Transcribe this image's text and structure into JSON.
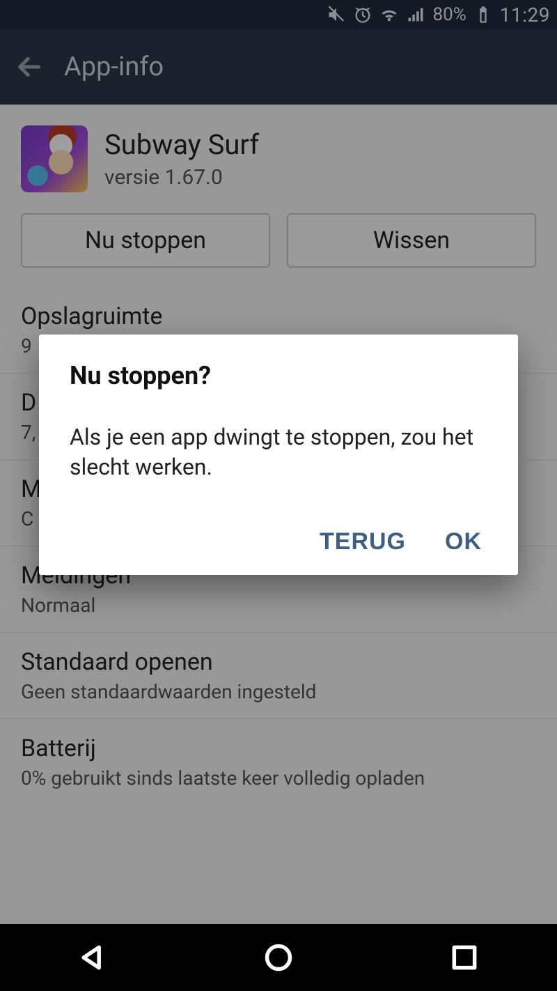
{
  "statusbar": {
    "battery_pct": "80%",
    "clock": "11:29"
  },
  "appbar": {
    "title": "App-info"
  },
  "app": {
    "name": "Subway Surf",
    "version": "versie 1.67.0"
  },
  "buttons": {
    "force_stop": "Nu stoppen",
    "uninstall": "Wissen"
  },
  "rows": {
    "storage": {
      "title": "Opslagruimte",
      "sub": "9"
    },
    "data": {
      "title": "D",
      "sub": "7,"
    },
    "memory": {
      "title": "M",
      "sub": "C"
    },
    "notif": {
      "title": "Meldingen",
      "sub": "Normaal"
    },
    "default": {
      "title": "Standaard openen",
      "sub": "Geen standaardwaarden ingesteld"
    },
    "battery": {
      "title": "Batterij",
      "sub": "0% gebruikt sinds laatste keer volledig opladen"
    }
  },
  "dialog": {
    "title": "Nu stoppen?",
    "body": "Als je een app dwingt te stoppen, zou het slecht werken.",
    "cancel": "TERUG",
    "ok": "OK"
  }
}
